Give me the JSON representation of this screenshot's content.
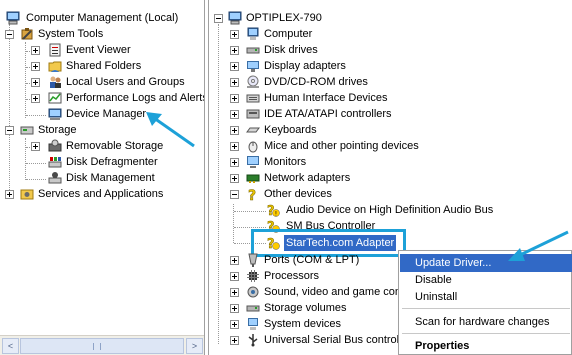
{
  "left_tree": [
    {
      "label": "Computer Management (Local)",
      "icon": "computer-management-icon"
    },
    {
      "label": "System Tools",
      "icon": "system-tools-icon"
    },
    {
      "label": "Event Viewer",
      "icon": "event-viewer-icon"
    },
    {
      "label": "Shared Folders",
      "icon": "shared-folders-icon"
    },
    {
      "label": "Local Users and Groups",
      "icon": "users-groups-icon"
    },
    {
      "label": "Performance Logs and Alerts",
      "icon": "performance-logs-icon"
    },
    {
      "label": "Device Manager",
      "icon": "device-manager-icon"
    },
    {
      "label": "Storage",
      "icon": "storage-icon"
    },
    {
      "label": "Removable Storage",
      "icon": "removable-storage-icon"
    },
    {
      "label": "Disk Defragmenter",
      "icon": "disk-defragmenter-icon"
    },
    {
      "label": "Disk Management",
      "icon": "disk-management-icon"
    },
    {
      "label": "Services and Applications",
      "icon": "services-applications-icon"
    }
  ],
  "left_scrollbar": {
    "left_arrow": "<",
    "right_arrow": ">"
  },
  "right_tree": [
    {
      "label": "OPTIPLEX-790",
      "icon": "computer-icon"
    },
    {
      "label": "Computer",
      "icon": "computer-icon"
    },
    {
      "label": "Disk drives",
      "icon": "disk-drive-icon"
    },
    {
      "label": "Display adapters",
      "icon": "display-adapter-icon"
    },
    {
      "label": "DVD/CD-ROM drives",
      "icon": "dvd-drive-icon"
    },
    {
      "label": "Human Interface Devices",
      "icon": "hid-icon"
    },
    {
      "label": "IDE ATA/ATAPI controllers",
      "icon": "ide-controller-icon"
    },
    {
      "label": "Keyboards",
      "icon": "keyboard-icon"
    },
    {
      "label": "Mice and other pointing devices",
      "icon": "mouse-icon"
    },
    {
      "label": "Monitors",
      "icon": "monitor-icon"
    },
    {
      "label": "Network adapters",
      "icon": "network-adapter-icon"
    },
    {
      "label": "Other devices",
      "icon": "unknown-device-icon"
    },
    {
      "label": "Audio Device on High Definition Audio Bus",
      "icon": "unknown-device-warning-icon"
    },
    {
      "label": "SM Bus Controller",
      "icon": "unknown-device-warning-icon"
    },
    {
      "label": "StarTech.com Adapter",
      "icon": "unknown-device-warning-icon"
    },
    {
      "label": "Ports (COM & LPT)",
      "icon": "port-icon"
    },
    {
      "label": "Processors",
      "icon": "processor-icon"
    },
    {
      "label": "Sound, video and game controllers",
      "icon": "sound-icon"
    },
    {
      "label": "Storage volumes",
      "icon": "storage-volume-icon"
    },
    {
      "label": "System devices",
      "icon": "system-device-icon"
    },
    {
      "label": "Universal Serial Bus controllers",
      "icon": "usb-icon"
    }
  ],
  "context_menu": {
    "update_driver": "Update Driver...",
    "disable": "Disable",
    "uninstall": "Uninstall",
    "scan": "Scan for hardware changes",
    "properties": "Properties"
  },
  "colors": {
    "selection": "#3169c6",
    "annotation": "#1da1d8"
  }
}
